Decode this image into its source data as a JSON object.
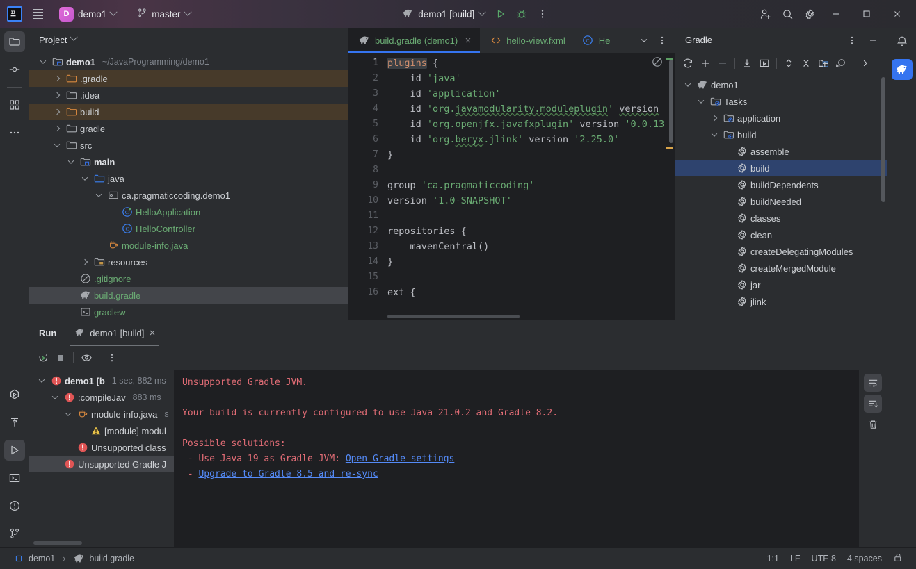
{
  "titlebar": {
    "logo": "IJ",
    "menu_icon": "hamburger-icon",
    "project_badge": "D",
    "project_name": "demo1",
    "branch_icon": "git-branch-icon",
    "branch_name": "master",
    "run_config": "demo1 [build]",
    "run_icon": "gradle-elephant-icon",
    "play_icon": "run-icon",
    "debug_icon": "debug-icon",
    "more_icon": "more-vertical-icon",
    "add_user_icon": "add-user-icon",
    "search_icon": "search-icon",
    "settings_icon": "gear-icon",
    "minimize_icon": "minimize-icon",
    "maximize_icon": "maximize-icon",
    "close_icon": "close-icon"
  },
  "left_stripe": [
    {
      "name": "project",
      "icon": "folder-icon",
      "active": true
    },
    {
      "name": "commit",
      "icon": "commit-icon",
      "active": false
    },
    {
      "name": "structure",
      "icon": "structure-icon",
      "active": false
    },
    {
      "name": "more-tool-windows",
      "icon": "more-horizontal-icon",
      "active": false
    }
  ],
  "left_stripe_bottom": [
    {
      "name": "services",
      "icon": "services-icon",
      "active": false
    },
    {
      "name": "build",
      "icon": "hammer-icon",
      "active": false
    },
    {
      "name": "run",
      "icon": "run-triangle-icon",
      "active": true
    },
    {
      "name": "terminal",
      "icon": "terminal-icon",
      "active": false
    },
    {
      "name": "problems",
      "icon": "problems-icon",
      "active": false
    },
    {
      "name": "version-control",
      "icon": "git-branch-icon",
      "active": false
    }
  ],
  "right_stripe": [
    {
      "name": "notifications",
      "icon": "bell-icon",
      "active": false
    },
    {
      "name": "gradle",
      "icon": "gradle-elephant-icon",
      "active": true
    }
  ],
  "project_panel": {
    "title": "Project",
    "tree": [
      {
        "indent": 0,
        "arrow": "open",
        "icon": "module-folder-icon",
        "label": "demo1",
        "bold": true,
        "sub": "~/JavaProgramming/demo1",
        "state": "normal"
      },
      {
        "indent": 1,
        "arrow": "closed",
        "icon": "folder-excluded-icon",
        "label": ".gradle",
        "bold": false,
        "sub": "",
        "state": "ignored"
      },
      {
        "indent": 1,
        "arrow": "closed",
        "icon": "folder-icon",
        "label": ".idea",
        "bold": false,
        "sub": "",
        "state": "normal"
      },
      {
        "indent": 1,
        "arrow": "closed",
        "icon": "folder-excluded-icon",
        "label": "build",
        "bold": false,
        "sub": "",
        "state": "ignored"
      },
      {
        "indent": 1,
        "arrow": "closed",
        "icon": "folder-icon",
        "label": "gradle",
        "bold": false,
        "sub": "",
        "state": "normal"
      },
      {
        "indent": 1,
        "arrow": "open",
        "icon": "folder-icon",
        "label": "src",
        "bold": false,
        "sub": "",
        "state": "normal"
      },
      {
        "indent": 2,
        "arrow": "open",
        "icon": "module-folder-icon",
        "label": "main",
        "bold": true,
        "sub": "",
        "state": "normal"
      },
      {
        "indent": 3,
        "arrow": "open",
        "icon": "source-root-icon",
        "label": "java",
        "bold": false,
        "sub": "",
        "state": "normal"
      },
      {
        "indent": 4,
        "arrow": "open",
        "icon": "package-icon",
        "label": "ca.pragmaticcoding.demo1",
        "bold": false,
        "sub": "",
        "state": "normal"
      },
      {
        "indent": 5,
        "arrow": "none",
        "icon": "java-class-runnable-icon",
        "label": "HelloApplication",
        "bold": false,
        "sub": "",
        "state": "green"
      },
      {
        "indent": 5,
        "arrow": "none",
        "icon": "java-class-icon",
        "label": "HelloController",
        "bold": false,
        "sub": "",
        "state": "green"
      },
      {
        "indent": 4,
        "arrow": "none",
        "icon": "java-file-icon",
        "label": "module-info.java",
        "bold": false,
        "sub": "",
        "state": "green"
      },
      {
        "indent": 3,
        "arrow": "closed",
        "icon": "resources-root-icon",
        "label": "resources",
        "bold": false,
        "sub": "",
        "state": "normal"
      },
      {
        "indent": 2,
        "arrow": "none",
        "icon": "gitignore-icon",
        "label": ".gitignore",
        "bold": false,
        "sub": "",
        "state": "green"
      },
      {
        "indent": 2,
        "arrow": "none",
        "icon": "gradle-elephant-icon",
        "label": "build.gradle",
        "bold": false,
        "sub": "",
        "state": "selected-green"
      },
      {
        "indent": 2,
        "arrow": "none",
        "icon": "script-icon",
        "label": "gradlew",
        "bold": false,
        "sub": "",
        "state": "green"
      }
    ]
  },
  "editor": {
    "tabs": [
      {
        "label": "build.gradle (demo1)",
        "icon": "gradle-elephant-icon",
        "active": true,
        "closable": true
      },
      {
        "label": "hello-view.fxml",
        "icon": "fxml-icon",
        "active": false,
        "closable": false
      },
      {
        "label": "He",
        "icon": "java-class-icon",
        "active": false,
        "closable": false
      }
    ],
    "tab_list_icon": "chevron-down-icon",
    "tab_more_icon": "more-vertical-icon",
    "inspection_icon": "inspections-off-icon",
    "lines": [
      {
        "n": "1",
        "segs": [
          {
            "t": "plugins",
            "c": "kw hl-word"
          },
          {
            "t": " {",
            "c": "pl"
          }
        ]
      },
      {
        "n": "2",
        "segs": [
          {
            "t": "    id ",
            "c": "pl"
          },
          {
            "t": "'java'",
            "c": "str"
          }
        ]
      },
      {
        "n": "3",
        "segs": [
          {
            "t": "    id ",
            "c": "pl"
          },
          {
            "t": "'application'",
            "c": "str"
          }
        ]
      },
      {
        "n": "4",
        "segs": [
          {
            "t": "    id ",
            "c": "pl"
          },
          {
            "t": "'org.",
            "c": "str"
          },
          {
            "t": "javamodularity.moduleplugin",
            "c": "str squig"
          },
          {
            "t": "' ",
            "c": "str"
          },
          {
            "t": "version",
            "c": "pl squig"
          }
        ]
      },
      {
        "n": "5",
        "segs": [
          {
            "t": "    id ",
            "c": "pl"
          },
          {
            "t": "'org.openjfx.javafxplugin'",
            "c": "str"
          },
          {
            "t": " version ",
            "c": "pl"
          },
          {
            "t": "'0.0.13",
            "c": "str"
          }
        ]
      },
      {
        "n": "6",
        "segs": [
          {
            "t": "    id ",
            "c": "pl"
          },
          {
            "t": "'org.",
            "c": "str"
          },
          {
            "t": "beryx",
            "c": "str squig"
          },
          {
            "t": ".jlink'",
            "c": "str"
          },
          {
            "t": " version ",
            "c": "pl"
          },
          {
            "t": "'2.25.0'",
            "c": "str"
          }
        ]
      },
      {
        "n": "7",
        "segs": [
          {
            "t": "}",
            "c": "pl"
          }
        ]
      },
      {
        "n": "8",
        "segs": []
      },
      {
        "n": "9",
        "segs": [
          {
            "t": "group ",
            "c": "pl"
          },
          {
            "t": "'ca.pragmaticcoding'",
            "c": "str"
          }
        ]
      },
      {
        "n": "10",
        "segs": [
          {
            "t": "version ",
            "c": "pl"
          },
          {
            "t": "'1.0-SNAPSHOT'",
            "c": "str"
          }
        ]
      },
      {
        "n": "11",
        "segs": []
      },
      {
        "n": "12",
        "segs": [
          {
            "t": "repositories {",
            "c": "pl"
          }
        ]
      },
      {
        "n": "13",
        "segs": [
          {
            "t": "    mavenCentral()",
            "c": "pl"
          }
        ]
      },
      {
        "n": "14",
        "segs": [
          {
            "t": "}",
            "c": "pl"
          }
        ]
      },
      {
        "n": "15",
        "segs": []
      },
      {
        "n": "16",
        "segs": [
          {
            "t": "ext {",
            "c": "pl"
          }
        ]
      }
    ]
  },
  "gradle_panel": {
    "title": "Gradle",
    "options_icon": "more-vertical-icon",
    "hide_icon": "minimize-icon",
    "toolbar": [
      {
        "name": "reload-all-gradle-projects",
        "icon": "refresh-icon"
      },
      {
        "name": "link-gradle-project",
        "icon": "plus-icon"
      },
      {
        "name": "detach-gradle-project",
        "icon": "minus-icon"
      },
      {
        "name": "download-sources",
        "icon": "download-icon"
      },
      {
        "name": "execute-gradle-task",
        "icon": "execute-task-icon"
      },
      {
        "name": "expand-all",
        "icon": "expand-all-icon"
      },
      {
        "name": "collapse-all",
        "icon": "collapse-all-icon"
      },
      {
        "name": "toggle-tasks-grouping",
        "icon": "group-tasks-icon"
      },
      {
        "name": "show-dependencies-analyzer",
        "icon": "analyzer-icon"
      },
      {
        "name": "more-toolbar-actions",
        "icon": "chevron-right-icon"
      }
    ],
    "tree": [
      {
        "indent": 0,
        "arrow": "open",
        "icon": "gradle-elephant-icon",
        "label": "demo1",
        "selected": false
      },
      {
        "indent": 1,
        "arrow": "open",
        "icon": "tasks-folder-icon",
        "label": "Tasks",
        "selected": false
      },
      {
        "indent": 2,
        "arrow": "closed",
        "icon": "tasks-folder-icon",
        "label": "application",
        "selected": false
      },
      {
        "indent": 2,
        "arrow": "open",
        "icon": "tasks-folder-icon",
        "label": "build",
        "selected": false
      },
      {
        "indent": 3,
        "arrow": "none",
        "icon": "gradle-task-icon",
        "label": "assemble",
        "selected": false
      },
      {
        "indent": 3,
        "arrow": "none",
        "icon": "gradle-task-icon",
        "label": "build",
        "selected": true
      },
      {
        "indent": 3,
        "arrow": "none",
        "icon": "gradle-task-icon",
        "label": "buildDependents",
        "selected": false
      },
      {
        "indent": 3,
        "arrow": "none",
        "icon": "gradle-task-icon",
        "label": "buildNeeded",
        "selected": false
      },
      {
        "indent": 3,
        "arrow": "none",
        "icon": "gradle-task-icon",
        "label": "classes",
        "selected": false
      },
      {
        "indent": 3,
        "arrow": "none",
        "icon": "gradle-task-icon",
        "label": "clean",
        "selected": false
      },
      {
        "indent": 3,
        "arrow": "none",
        "icon": "gradle-task-icon",
        "label": "createDelegatingModules",
        "selected": false
      },
      {
        "indent": 3,
        "arrow": "none",
        "icon": "gradle-task-icon",
        "label": "createMergedModule",
        "selected": false
      },
      {
        "indent": 3,
        "arrow": "none",
        "icon": "gradle-task-icon",
        "label": "jar",
        "selected": false
      },
      {
        "indent": 3,
        "arrow": "none",
        "icon": "gradle-task-icon",
        "label": "jlink",
        "selected": false
      }
    ]
  },
  "run_panel": {
    "title": "Run",
    "tab_label": "demo1 [build]",
    "tab_icon": "gradle-elephant-icon",
    "toolbar": [
      {
        "name": "rerun-build",
        "icon": "rerun-icon"
      },
      {
        "name": "stop-build",
        "icon": "stop-icon"
      },
      {
        "name": "toggle-auto-show",
        "icon": "eye-icon"
      },
      {
        "name": "more-run-actions",
        "icon": "more-vertical-icon"
      }
    ],
    "tree": [
      {
        "indent": 0,
        "arrow": "open",
        "icon": "error-icon",
        "label": "demo1 [b",
        "time": "1 sec, 882 ms",
        "selected": false
      },
      {
        "indent": 1,
        "arrow": "open",
        "icon": "error-icon",
        "label": ":compileJav",
        "time": "883 ms",
        "selected": false
      },
      {
        "indent": 2,
        "arrow": "open",
        "icon": "java-file-icon",
        "label": "module-info.java",
        "time": "s",
        "selected": false
      },
      {
        "indent": 3,
        "arrow": "none",
        "icon": "warning-icon",
        "label": "[module] modul",
        "time": "",
        "selected": false
      },
      {
        "indent": 2,
        "arrow": "none",
        "icon": "error-icon",
        "label": "Unsupported class",
        "time": "",
        "selected": false
      },
      {
        "indent": 1,
        "arrow": "none",
        "icon": "error-icon",
        "label": "Unsupported Gradle J",
        "time": "",
        "selected": true
      }
    ],
    "console": [
      {
        "text": "Unsupported Gradle JVM.",
        "type": "error"
      },
      {
        "text": "",
        "type": "blank"
      },
      {
        "text": "Your build is currently configured to use Java 21.0.2 and Gradle 8.2.",
        "type": "error"
      },
      {
        "text": "",
        "type": "blank"
      },
      {
        "text": "Possible solutions:",
        "type": "error"
      },
      {
        "text": " - Use Java 19 as Gradle JVM: ",
        "link": "Open Gradle settings",
        "type": "error-link"
      },
      {
        "text": " - ",
        "link": "Upgrade to Gradle 8.5 and re-sync",
        "type": "error-link"
      }
    ],
    "gutter": [
      {
        "name": "soft-wrap-toggle",
        "icon": "soft-wrap-icon",
        "active": true
      },
      {
        "name": "scroll-to-end",
        "icon": "scroll-to-end-icon",
        "active": true
      },
      {
        "name": "clear-all",
        "icon": "trash-icon",
        "active": false
      }
    ]
  },
  "status_bar": {
    "breadcrumb": [
      {
        "icon": "module-icon",
        "label": "demo1"
      },
      {
        "icon": "gradle-elephant-icon",
        "label": "build.gradle"
      }
    ],
    "separator": "›",
    "caret_position": "1:1",
    "line_separator": "LF",
    "encoding": "UTF-8",
    "indent": "4 spaces",
    "lock_icon": "unlocked-icon"
  },
  "colors": {
    "accent": "#3574f0",
    "selection": "#2e436e",
    "error": "#e06c75",
    "string": "#6aab73",
    "keyword": "#cf8e6d",
    "warn_bg": "#473a2a"
  }
}
